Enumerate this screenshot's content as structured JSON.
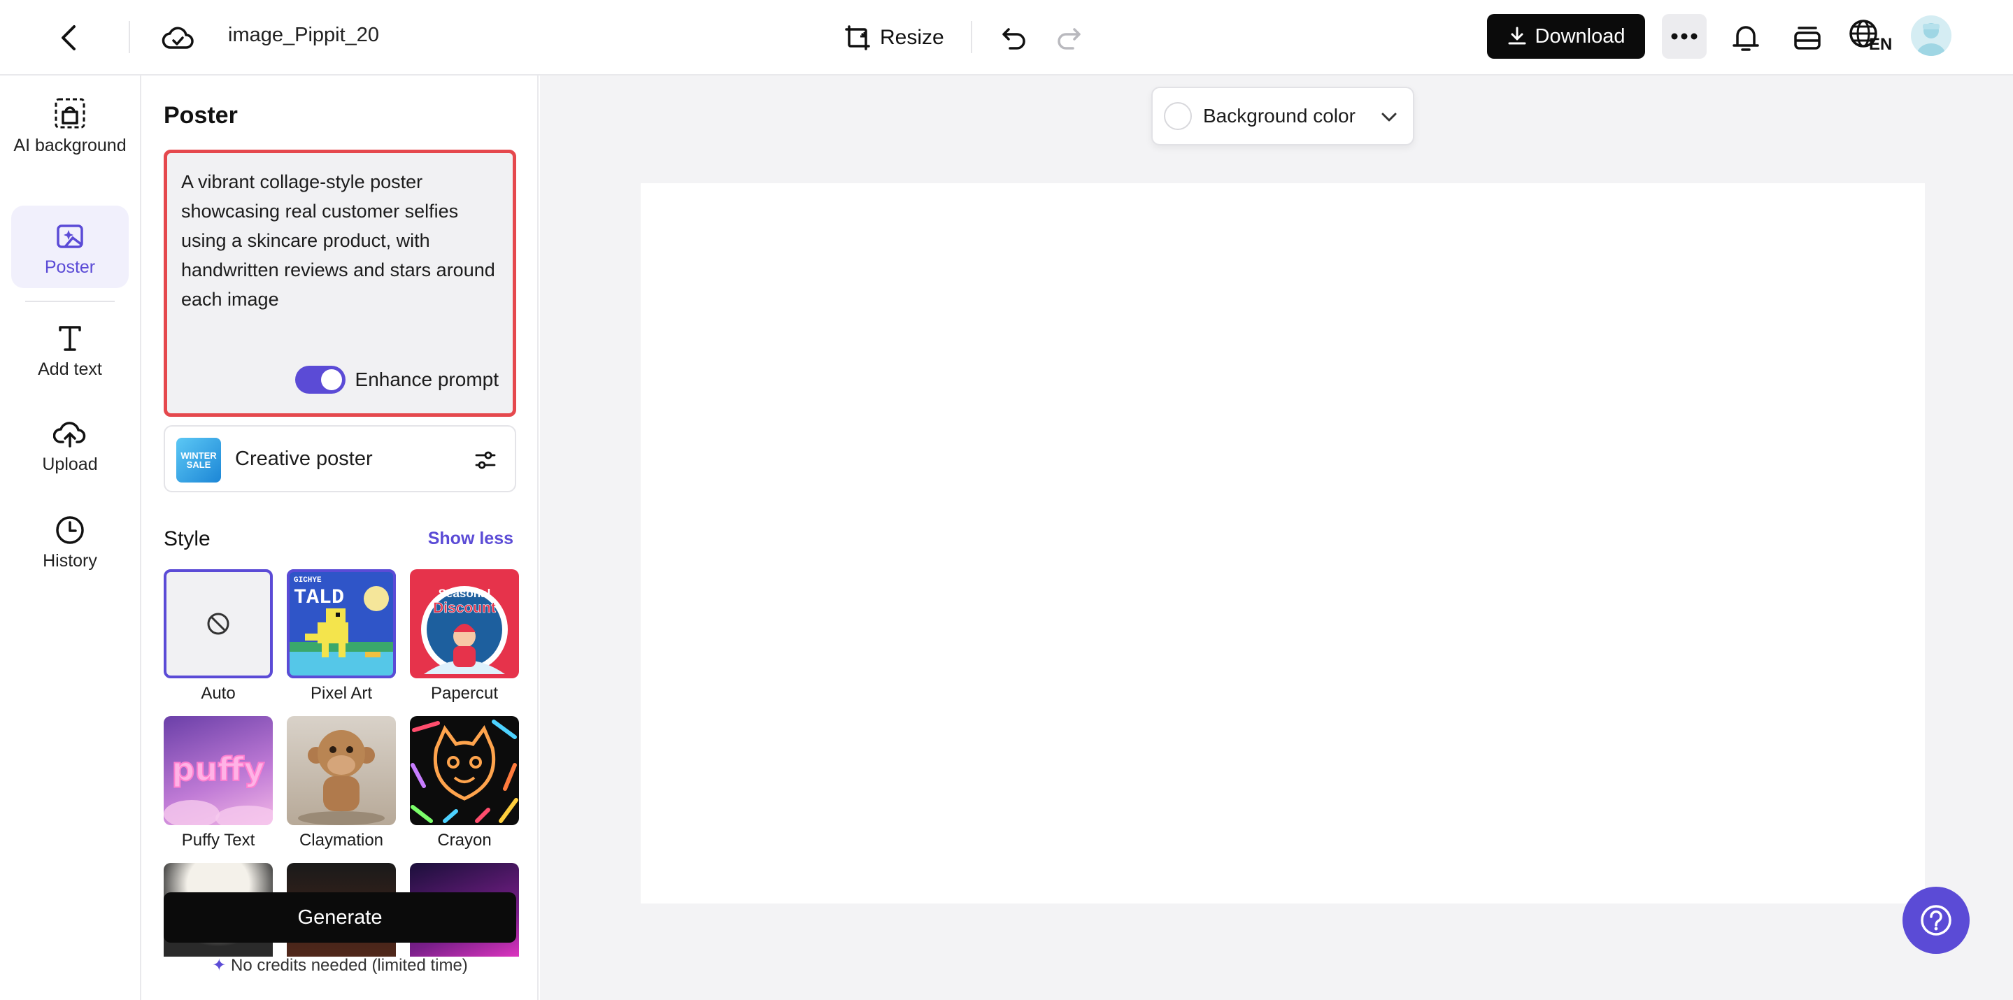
{
  "header": {
    "title": "image_Pippit_20",
    "resize_label": "Resize",
    "download_label": "Download",
    "language": "EN"
  },
  "rail": {
    "items": [
      {
        "label": "AI background",
        "icon": "ai-background-icon"
      },
      {
        "label": "Poster",
        "icon": "poster-icon",
        "active": true
      },
      {
        "label": "Add text",
        "icon": "text-icon"
      },
      {
        "label": "Upload",
        "icon": "upload-cloud-icon"
      },
      {
        "label": "History",
        "icon": "clock-icon"
      }
    ]
  },
  "panel": {
    "title": "Poster",
    "prompt": "A vibrant collage-style poster showcasing real customer selfies using a skincare product, with handwritten reviews and stars around each image",
    "enhance_label": "Enhance prompt",
    "enhance_enabled": true,
    "poster_type": {
      "label": "Creative poster",
      "thumb_text": "WINTER SALE"
    },
    "style_header": "Style",
    "show_less": "Show less",
    "styles": [
      {
        "name": "Auto",
        "selected": true
      },
      {
        "name": "Pixel Art"
      },
      {
        "name": "Papercut"
      },
      {
        "name": "Puffy Text"
      },
      {
        "name": "Claymation"
      },
      {
        "name": "Crayon"
      }
    ],
    "style_thumb_text": {
      "pixel_art": "TALD",
      "pixel_art_small": "GICHYE",
      "papercut_1": "Seasonal",
      "papercut_2": "Discount",
      "puffy": "puffy"
    },
    "generate_label": "Generate",
    "credits_note": "No credits needed (limited time)"
  },
  "canvas": {
    "background_color_label": "Background color"
  },
  "colors": {
    "accent": "#5b4bd6",
    "highlight_border": "#e5484d",
    "primary_button": "#0b0b0b"
  }
}
